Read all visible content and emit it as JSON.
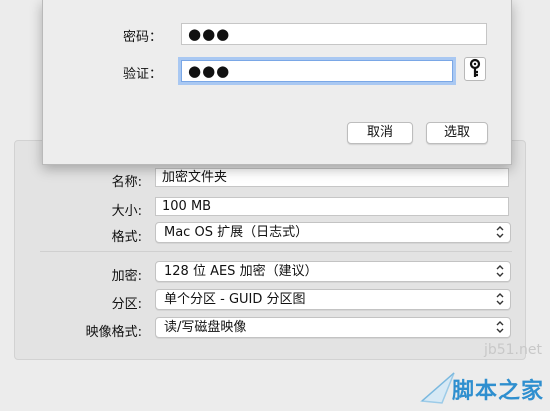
{
  "sheet": {
    "password_label": "密码：",
    "password_value": "●●●",
    "verify_label": "验证：",
    "verify_value": "●●●",
    "key_icon": "key-icon",
    "cancel_label": "取消",
    "choose_label": "选取"
  },
  "form": {
    "name_label": "名称:",
    "name_value": "加密文件夹",
    "size_label": "大小:",
    "size_value": "100 MB",
    "format_label": "格式:",
    "format_value": "Mac OS 扩展（日志式）",
    "encryption_label": "加密:",
    "encryption_value": "128 位 AES 加密（建议）",
    "partition_label": "分区:",
    "partition_value": "单个分区 - GUID 分区图",
    "image_format_label": "映像格式:",
    "image_format_value": "读/写磁盘映像"
  },
  "watermark": {
    "url": "jb51.net",
    "name": "脚本之家"
  },
  "colors": {
    "focus_ring": "#a9c8f2",
    "watermark_blue": "#2f8fcf"
  }
}
